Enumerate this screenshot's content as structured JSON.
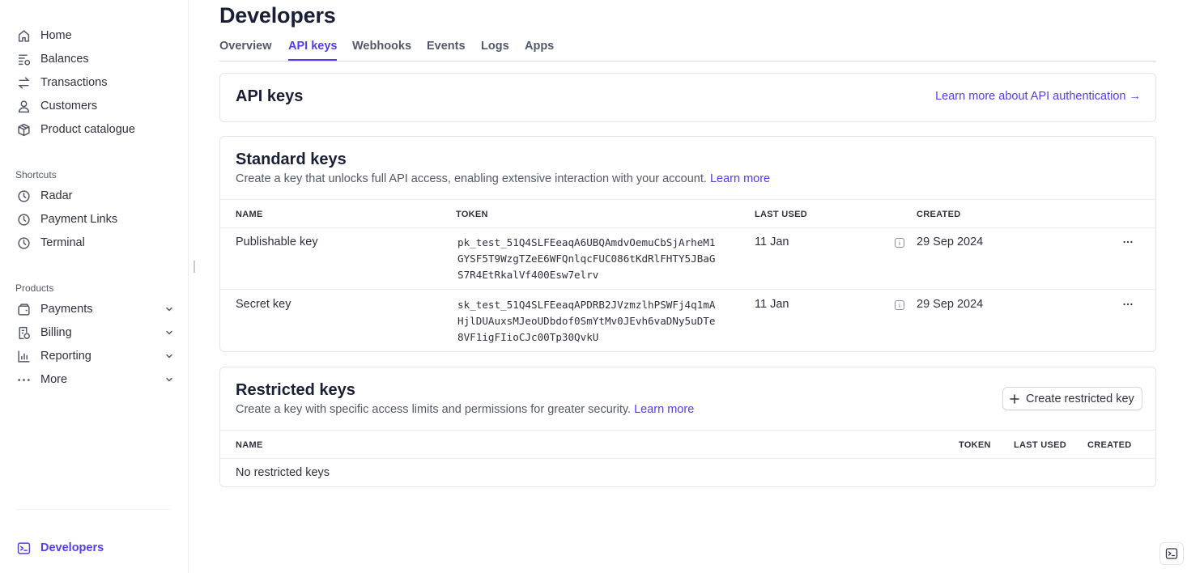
{
  "sidebar": {
    "items": [
      {
        "label": "Home",
        "icon": "home-icon"
      },
      {
        "label": "Balances",
        "icon": "balances-icon"
      },
      {
        "label": "Transactions",
        "icon": "transactions-icon"
      },
      {
        "label": "Customers",
        "icon": "customers-icon"
      },
      {
        "label": "Product catalogue",
        "icon": "product-catalogue-icon"
      }
    ],
    "shortcuts_label": "Shortcuts",
    "shortcuts": [
      {
        "label": "Radar",
        "icon": "clock-icon"
      },
      {
        "label": "Payment Links",
        "icon": "clock-icon"
      },
      {
        "label": "Terminal",
        "icon": "clock-icon"
      }
    ],
    "products_label": "Products",
    "products": [
      {
        "label": "Payments",
        "icon": "payments-icon"
      },
      {
        "label": "Billing",
        "icon": "billing-icon"
      },
      {
        "label": "Reporting",
        "icon": "reporting-icon"
      },
      {
        "label": "More",
        "icon": "more-dots-icon"
      }
    ],
    "developers_label": "Developers"
  },
  "page": {
    "title": "Developers",
    "tabs": [
      "Overview",
      "API keys",
      "Webhooks",
      "Events",
      "Logs",
      "Apps"
    ],
    "active_tab": "API keys"
  },
  "api_keys_card": {
    "title": "API keys",
    "learn_link": "Learn more about API authentication →"
  },
  "standard_keys": {
    "title": "Standard keys",
    "description": "Create a key that unlocks full API access, enabling extensive interaction with your account.",
    "learn_more": "Learn more",
    "columns": [
      "NAME",
      "TOKEN",
      "LAST USED",
      "CREATED"
    ],
    "rows": [
      {
        "name": "Publishable key",
        "token_lines": [
          "pk_test_51Q4SLFEeaqA6UBQAmdvOemuCbSjArheM1",
          "GYSF5T9WzgTZeE6WFQnlqcFUC086tKdRlFHTY5JBaG",
          "S7R4EtRkalVf400Esw7elrv"
        ],
        "last_used": "11 Jan",
        "created": "29 Sep 2024"
      },
      {
        "name": "Secret key",
        "token_lines": [
          "sk_test_51Q4SLFEeaqAPDRB2JVzmzlhPSWFj4q1mA",
          "HjlDUAuxsMJeoUDbdof0SmYtMv0JEvh6vaDNy5uDTe",
          "8VF1igFIioCJc00Tp30QvkU"
        ],
        "last_used": "11 Jan",
        "created": "29 Sep 2024"
      }
    ]
  },
  "restricted_keys": {
    "title": "Restricted keys",
    "description": "Create a key with specific access limits and permissions for greater security.",
    "learn_more": "Learn more",
    "create_button": "Create restricted key",
    "columns": [
      "NAME",
      "TOKEN",
      "LAST USED",
      "CREATED"
    ],
    "empty_text": "No restricted keys"
  },
  "colors": {
    "accent": "#533afd",
    "text": "#1a1f36",
    "muted": "#545969",
    "border": "#e3e5e8"
  }
}
